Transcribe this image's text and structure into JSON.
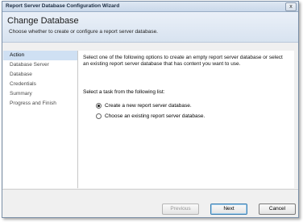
{
  "window": {
    "title": "Report Server Database Configuration Wizard",
    "close_glyph": "x"
  },
  "header": {
    "title": "Change Database",
    "subtitle": "Choose whether to create or configure a report server database."
  },
  "sidebar": {
    "items": [
      {
        "label": "Action",
        "active": true
      },
      {
        "label": "Database Server",
        "active": false
      },
      {
        "label": "Database",
        "active": false
      },
      {
        "label": "Credentials",
        "active": false
      },
      {
        "label": "Summary",
        "active": false
      },
      {
        "label": "Progress and Finish",
        "active": false
      }
    ]
  },
  "main": {
    "intro": "Select one of the following options to create an empty report server database or select an existing report server database that has content you want to use.",
    "select_label": "Select a task from the following list:",
    "options": [
      {
        "label": "Create a new report server database.",
        "checked": true
      },
      {
        "label": "Choose an existing report server database.",
        "checked": false
      }
    ]
  },
  "footer": {
    "previous": "Previous",
    "next": "Next",
    "cancel": "Cancel"
  }
}
